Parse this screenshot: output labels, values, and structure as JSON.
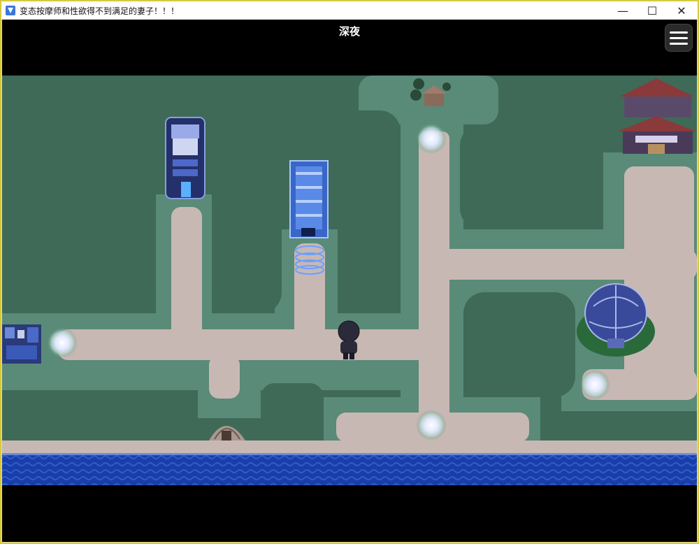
{
  "window": {
    "title": "变态按摩师和性欲得不到满足的妻子！！！",
    "controls": {
      "minimize": "—",
      "maximize": "☐",
      "close": "✕"
    }
  },
  "hud": {
    "time_of_day": "深夜",
    "menu_icon": "hamburger-menu-icon"
  },
  "colors": {
    "grass": "#3f6a58",
    "grass_edge": "#5a8a78",
    "road": "#c8b8b4",
    "water": "#1a3ea8",
    "hotspot": "#e8ecff"
  }
}
